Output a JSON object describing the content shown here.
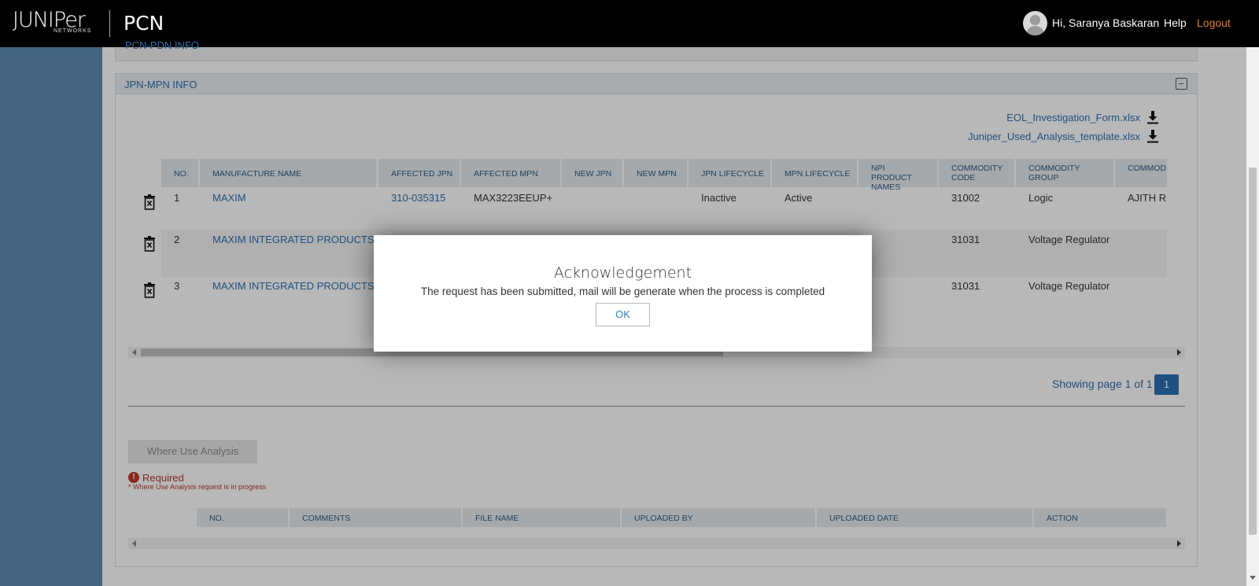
{
  "header": {
    "logo_word": "JUNIPer",
    "logo_sub": "NETWORKS",
    "app_name": "PCN",
    "greeting": "Hi, Saranya Baskaran",
    "help": "Help",
    "logout": "Logout"
  },
  "prev_panel": {
    "title": "PCN-PDN INFO"
  },
  "panel": {
    "title": "JPN-MPN INFO",
    "downloads": [
      "EOL_Investigation_Form.xlsx",
      "Juniper_Used_Analysis_template.xlsx"
    ],
    "columns": [
      "NO.",
      "MANUFACTURE NAME",
      "AFFECTED JPN",
      "AFFECTED MPN",
      "NEW JPN",
      "NEW MPN",
      "JPN LIFECYCLE",
      "MPN LIFECYCLE",
      "NPI PRODUCT NAMES",
      "COMMODITY CODE",
      "COMMODITY GROUP",
      "COMMODITY MANAGER"
    ],
    "rows": [
      {
        "no": "1",
        "manufacturer": "MAXIM",
        "affected_jpn": "310-035315",
        "affected_mpn": "MAX3223EEUP+",
        "jpn_lifecycle": "Inactive",
        "mpn_lifecycle": "Active",
        "commodity_code": "31002",
        "commodity_group": "Logic",
        "commodity_manager": "AJITH R"
      },
      {
        "no": "2",
        "manufacturer": "MAXIM INTEGRATED PRODUCTS",
        "commodity_code": "31031",
        "commodity_group": "Voltage Regulator"
      },
      {
        "no": "3",
        "manufacturer": "MAXIM INTEGRATED PRODUCTS",
        "commodity_code": "31031",
        "commodity_group": "Voltage Regulator"
      }
    ],
    "pager_text": "Showing page 1 of 1",
    "pager_page": "1",
    "where_use_button": "Where Use Analysis",
    "required_label": "Required",
    "required_note": "* Where Use Analysis request is in progress",
    "upload_columns": [
      "NO.",
      "COMMENTS",
      "FILE NAME",
      "UPLOADED BY",
      "UPLOADED DATE",
      "ACTION"
    ]
  },
  "modal": {
    "title": "Acknowledgement",
    "message": "The request has been submitted, mail will be generate when the process is completed",
    "ok": "OK"
  },
  "colors": {
    "accent": "#2c6fb0",
    "logout": "#e07b28",
    "sidebar": "#5f8bb0",
    "required": "#c0392b"
  }
}
